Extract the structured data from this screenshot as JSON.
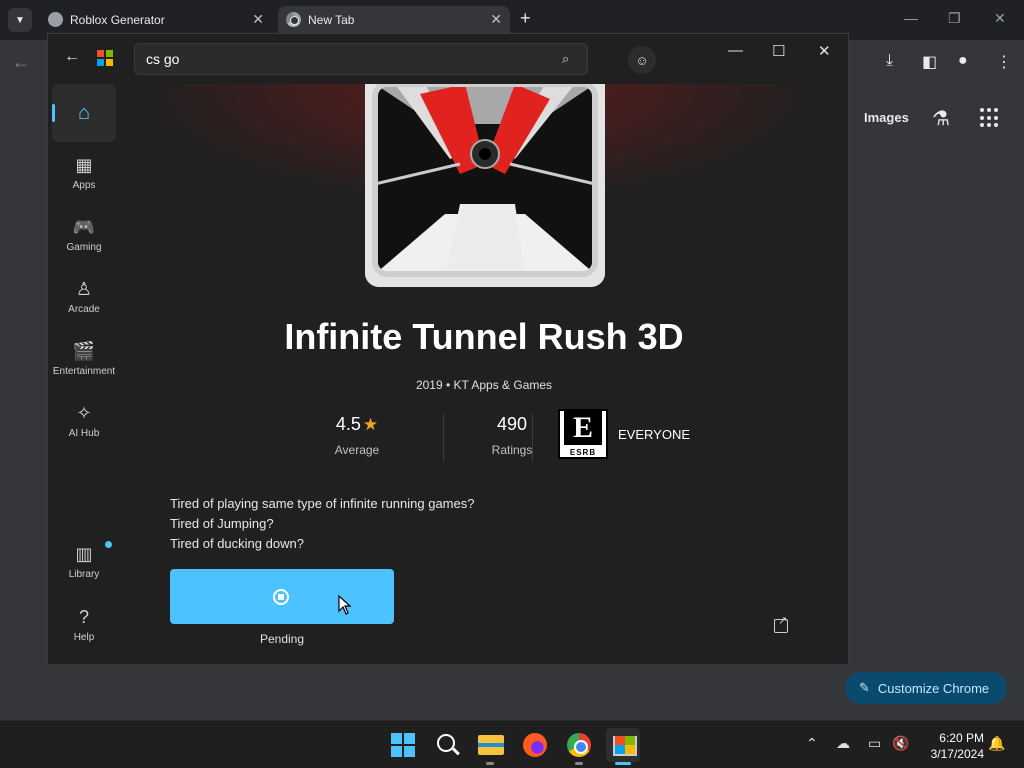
{
  "chrome": {
    "tabs": [
      {
        "title": "Roblox Generator",
        "close": "✕"
      },
      {
        "title": "New Tab",
        "close": "✕"
      }
    ],
    "new_tab": "+",
    "window_controls": {
      "minimize": "—",
      "restore": "❐",
      "close": "✕"
    },
    "toolbar": {
      "back": "←",
      "download": "⤓",
      "side_panel": "◧",
      "profile": "●",
      "menu": "⋮"
    },
    "ntp": {
      "images_label": "Images",
      "labs_icon": "⚗",
      "customize_label": "Customize Chrome",
      "customize_icon": "✎"
    }
  },
  "store": {
    "back": "←",
    "search": {
      "value": "cs go",
      "icon": "⌕"
    },
    "account_icon": "☺",
    "window_controls": {
      "minimize": "—",
      "maximize": "☐",
      "close": "✕"
    },
    "nav": [
      {
        "label": "",
        "icon": "⌂"
      },
      {
        "label": "Apps",
        "icon": "▦"
      },
      {
        "label": "Gaming",
        "icon": "🎮"
      },
      {
        "label": "Arcade",
        "icon": "♙"
      },
      {
        "label": "Entertainment",
        "icon": "🎬"
      },
      {
        "label": "AI Hub",
        "icon": "✧"
      },
      {
        "label": "Library",
        "icon": "▥"
      },
      {
        "label": "Help",
        "icon": "?"
      }
    ],
    "app": {
      "title": "Infinite Tunnel Rush 3D",
      "year": "2019",
      "separator": "•",
      "publisher": "KT Apps & Games",
      "rating": "4.5",
      "rating_label": "Average",
      "ratings_count": "490",
      "ratings_label": "Ratings",
      "esrb_letter": "E",
      "esrb_text": "ESRB",
      "esrb_rating": "EVERYONE",
      "description": [
        "Tired of playing same type of infinite running games?",
        "Tired of Jumping?",
        "Tired of ducking down?"
      ],
      "install_status": "Pending",
      "star_icon": "★"
    }
  },
  "taskbar": {
    "time": "6:20 PM",
    "date": "3/17/2024",
    "tray": {
      "chevron": "⌃",
      "cloud": "☁",
      "display": "▭",
      "volume": "🔇",
      "bell": "🔔"
    }
  },
  "colors": {
    "accent": "#4cc2ff",
    "star": "#f7a21b",
    "store_bg": "#202020",
    "chrome_bg": "#35363a"
  }
}
